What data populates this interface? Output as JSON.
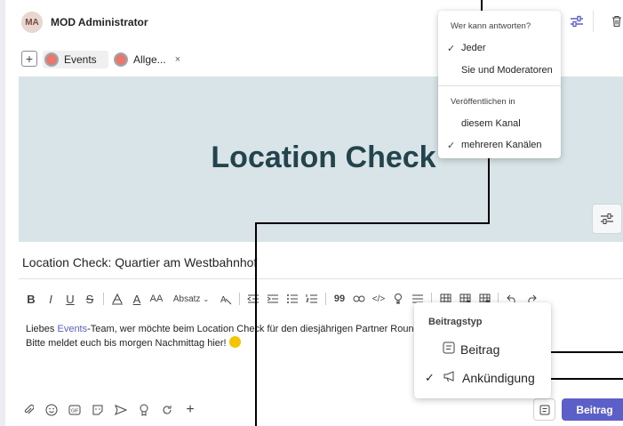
{
  "header": {
    "avatar_initials": "MA",
    "author": "MOD Administrator"
  },
  "channels": {
    "add_label": "+",
    "chips": [
      {
        "label": "Events"
      },
      {
        "label": "Allge...",
        "remove": "×"
      }
    ]
  },
  "banner": {
    "title": "Location Check",
    "bg_color": "#d8e4e7",
    "title_color": "#23434d"
  },
  "subject": "Location Check: Quartier am Westbahnhof",
  "toolbar": {
    "bold": "B",
    "italic": "I",
    "underline": "U",
    "strike": "S",
    "font_color": "A",
    "font_size": "AA",
    "paragraph_label": "Absatz",
    "quote": "99"
  },
  "message": {
    "line1_before": "Liebes ",
    "line1_link": "Events",
    "line1_after": "-Team, wer möchte beim Location Check für den diesjährigen Partner Round Tab",
    "line2": "Bitte meldet euch bis morgen Nachmittag hier! "
  },
  "post_button": "Beitrag",
  "reply_menu": {
    "heading1": "Wer kann antworten?",
    "items1": [
      {
        "label": "Jeder",
        "checked": "✓"
      },
      {
        "label": "Sie und Moderatoren",
        "checked": ""
      }
    ],
    "heading2": "Veröffentlichen in",
    "items2": [
      {
        "label": "diesem Kanal",
        "checked": ""
      },
      {
        "label": "mehreren Kanälen",
        "checked": "✓"
      }
    ]
  },
  "post_type_menu": {
    "heading": "Beitragstyp",
    "items": [
      {
        "label": "Beitrag",
        "checked": "",
        "icon": "post-icon"
      },
      {
        "label": "Ankündigung",
        "checked": "✓",
        "icon": "megaphone-icon"
      }
    ]
  },
  "colors": {
    "accent": "#5b5fc7",
    "link": "#5b5fc7"
  }
}
